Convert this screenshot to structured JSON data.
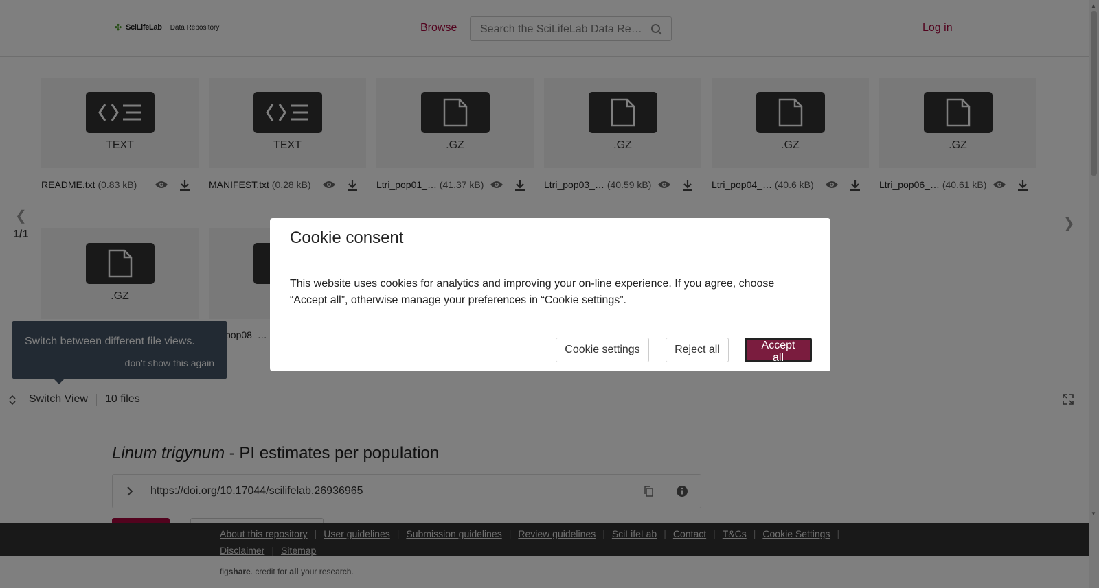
{
  "header": {
    "logo_brand": "SciLifeLab",
    "logo_sub": "Data Repository",
    "browse_label": "Browse",
    "search_placeholder": "Search the SciLifeLab Data Repository",
    "login_label": "Log in"
  },
  "files_row1": [
    {
      "type": "TEXT",
      "name": "README.txt",
      "size": "(0.83 kB)",
      "icon": "code-icon"
    },
    {
      "type": "TEXT",
      "name": "MANIFEST.txt",
      "size": "(0.28 kB)",
      "icon": "code-icon"
    },
    {
      "type": ".GZ",
      "name": "Ltri_pop01_…",
      "size": "(41.37 kB)",
      "icon": "file-icon"
    },
    {
      "type": ".GZ",
      "name": "Ltri_pop03_…",
      "size": "(40.59 kB)",
      "icon": "file-icon"
    },
    {
      "type": ".GZ",
      "name": "Ltri_pop04_…",
      "size": "(40.6 kB)",
      "icon": "file-icon"
    },
    {
      "type": ".GZ",
      "name": "Ltri_pop06_…",
      "size": "(40.61 kB)",
      "icon": "file-icon"
    }
  ],
  "files_row2": [
    {
      "type": ".GZ",
      "icon": "file-icon"
    },
    {
      "partial_name": "pop08_…"
    }
  ],
  "pager": {
    "page": "1/1"
  },
  "tooltip": {
    "message": "Switch between different file views.",
    "dismiss": "don't show this again"
  },
  "switchbar": {
    "label": "Switch View",
    "count": "10 files"
  },
  "dataset": {
    "title_italic": "Linum trigynum",
    "title_rest": " - PI estimates per population",
    "doi": "https://doi.org/10.17044/scilifelab.26936965"
  },
  "footer": {
    "links": [
      "About this repository",
      "User guidelines",
      "Submission guidelines",
      "Review guidelines",
      "SciLifeLab",
      "Contact",
      "T&Cs",
      "Cookie Settings",
      "Disclaimer",
      "Sitemap"
    ],
    "credit_pre": "fig",
    "credit_brand": "share",
    "credit_mid": ". credit for ",
    "credit_all": "all",
    "credit_post": " your research."
  },
  "cookie_modal": {
    "title": "Cookie consent",
    "body": "This website uses cookies for analytics and improving your on-line experience. If you agree, choose “Accept all”, otherwise manage your preferences in “Cookie settings”.",
    "settings_label": "Cookie settings",
    "reject_label": "Reject all",
    "accept_label": "Accept all"
  },
  "colors": {
    "accent": "#a5063d",
    "accept_button": "#7a1c3e",
    "footer_bg": "#333333",
    "tooltip_bg": "#445566"
  }
}
